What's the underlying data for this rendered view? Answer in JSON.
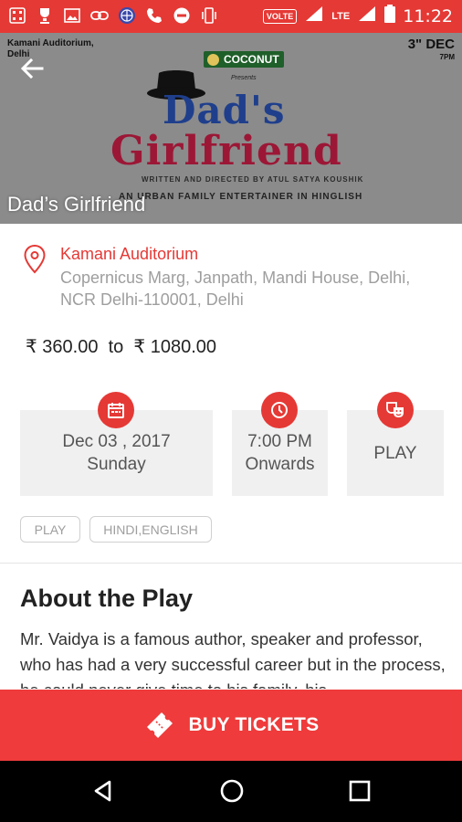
{
  "status_bar": {
    "left_icons": [
      "grid-icon",
      "trophy-icon",
      "image-icon",
      "link-icon",
      "globe-icon",
      "call-icon",
      "block-icon",
      "vibrate-icon"
    ],
    "volte": "VOLTE",
    "lte": "LTE",
    "time": "11:22"
  },
  "banner": {
    "poster_venue": "Kamani Auditorium, Delhi",
    "poster_date": "3\" DEC",
    "poster_time": "7PM",
    "poster_brand": "COCONUT",
    "poster_presents": "Presents",
    "poster_title_line1": "Dad's",
    "poster_title_line2": "Girlfriend",
    "poster_credit": "WRITTEN AND DIRECTED BY ATUL SATYA KOUSHIK",
    "poster_tagline": "AN URBAN FAMILY ENTERTAINER IN HINGLISH",
    "title": "Dad’s Girlfriend",
    "background": "#8b8b8b"
  },
  "venue": {
    "name": "Kamani Auditorium",
    "address": "Copernicus Marg, Janpath, Mandi House, Delhi, NCR Delhi-110001, Delhi"
  },
  "price": {
    "currency_symbol": "₹",
    "min": "360.00",
    "to": "to",
    "max": "1080.00"
  },
  "cards": {
    "date": {
      "line1": "Dec 03 , 2017",
      "line2": "Sunday",
      "icon": "calendar-icon"
    },
    "time": {
      "line1": "7:00 PM",
      "line2": "Onwards",
      "icon": "clock-icon"
    },
    "genre": {
      "line1": "PLAY",
      "icon": "theater-masks-icon"
    }
  },
  "tags": [
    "PLAY",
    "HINDI,ENGLISH"
  ],
  "about": {
    "title": "About the Play",
    "text": "Mr. Vaidya is a famous author, speaker and professor, who has had a very successful career but in the process, he could never give time to his family, his"
  },
  "buy": {
    "label": "BUY TICKETS",
    "icon": "ticket-icon"
  },
  "colors": {
    "accent": "#e53935",
    "button": "#ef3b3b",
    "card_bg": "#f0f0f0",
    "muted_text": "#9e9e9e"
  }
}
